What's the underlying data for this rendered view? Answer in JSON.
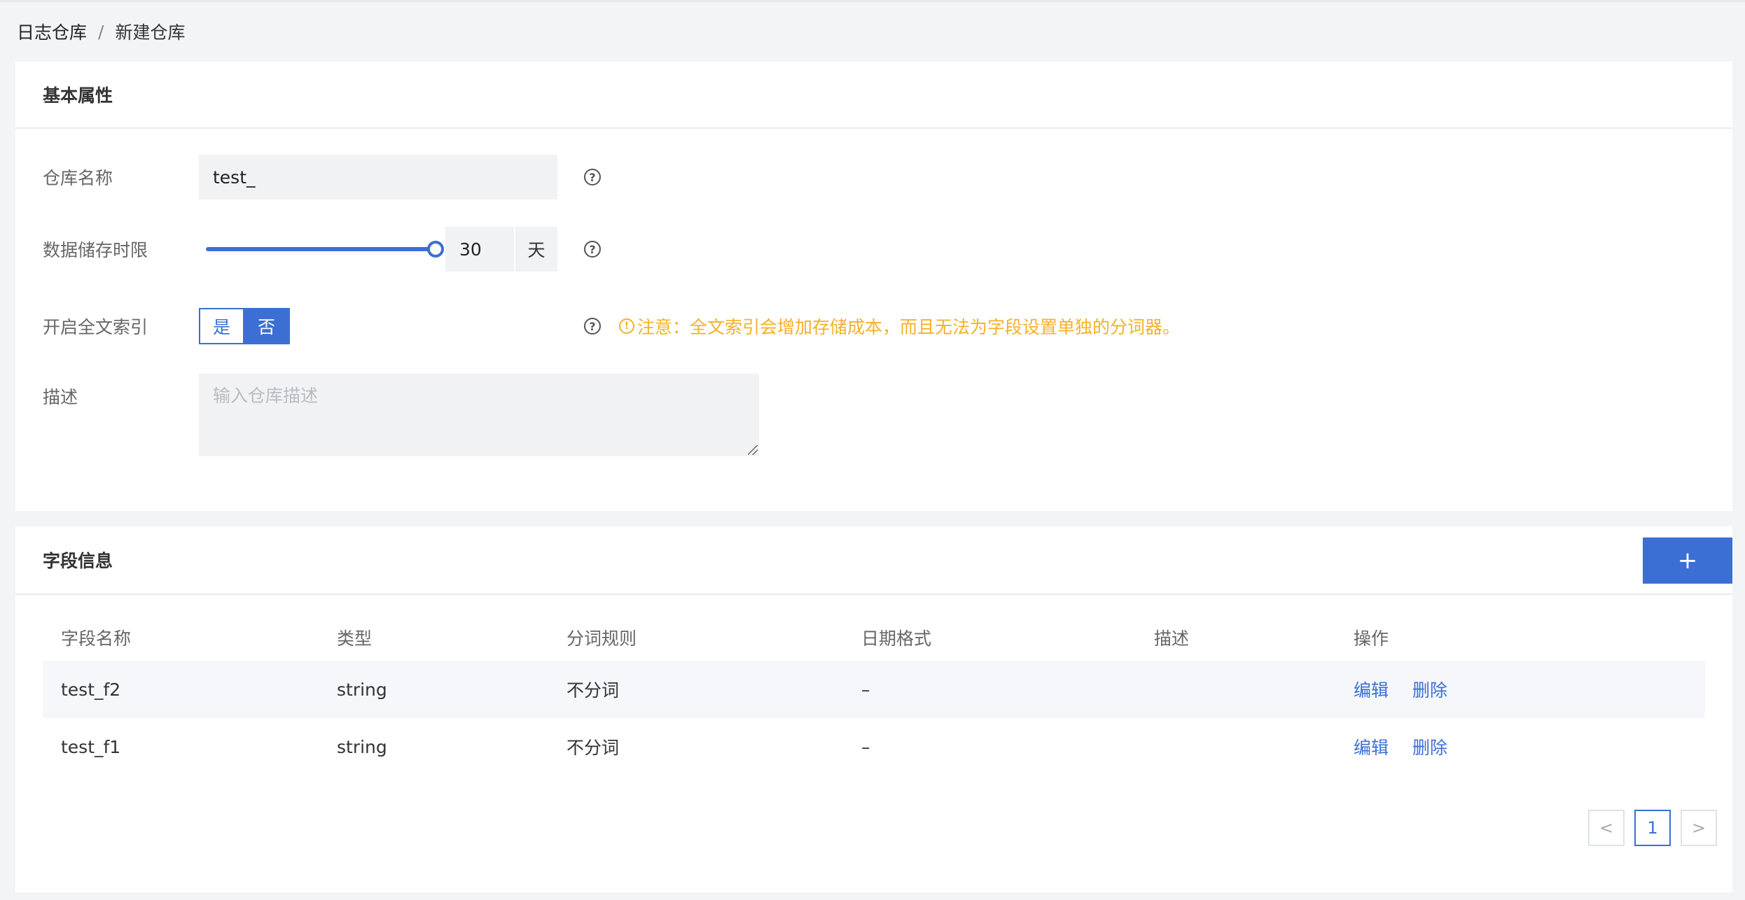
{
  "breadcrumb": {
    "root": "日志仓库",
    "separator": "/",
    "current": "新建仓库"
  },
  "basic": {
    "title": "基本属性",
    "name_label": "仓库名称",
    "name_value": "test_",
    "retention_label": "数据储存时限",
    "retention_value": "30",
    "retention_unit": "天",
    "retention_fraction": 1.0,
    "fulltext_label": "开启全文索引",
    "fulltext_yes": "是",
    "fulltext_no": "否",
    "fulltext_selected": "否",
    "warning_icon": "!",
    "warning_text": "注意：全文索引会增加存储成本，而且无法为字段设置单独的分词器。",
    "desc_label": "描述",
    "desc_placeholder": "输入仓库描述",
    "help_glyph": "?"
  },
  "fields": {
    "title": "字段信息",
    "add_label": "+",
    "columns": [
      "字段名称",
      "类型",
      "分词规则",
      "日期格式",
      "描述",
      "操作"
    ],
    "rows": [
      {
        "name": "test_f2",
        "type": "string",
        "tokenizer": "不分词",
        "date_format": "–",
        "desc": "",
        "edit": "编辑",
        "delete": "删除"
      },
      {
        "name": "test_f1",
        "type": "string",
        "tokenizer": "不分词",
        "date_format": "–",
        "desc": "",
        "edit": "编辑",
        "delete": "删除"
      }
    ]
  },
  "pagination": {
    "prev": "<",
    "current": "1",
    "next": ">"
  },
  "colors": {
    "primary": "#3b6fd4",
    "warning": "#f5b027"
  }
}
